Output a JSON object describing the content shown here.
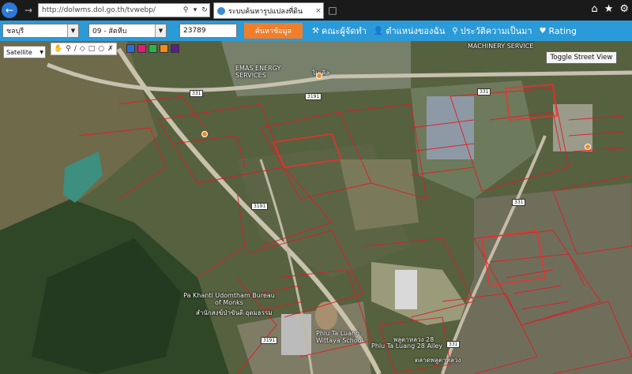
{
  "browser": {
    "url": "http://dolwms.dol.go.th/tvwebp/",
    "tab_title": "ระบบค้นหารูปแปลงที่ดิน",
    "tab_close": "×",
    "icons": [
      "back-arrow",
      "forward-arrow",
      "search",
      "refresh",
      "home",
      "star",
      "gear"
    ]
  },
  "toolbar": {
    "province": "ชลบุรี",
    "district": "09 - สัตหีบ",
    "parcel_number": "23789",
    "search_label": "ค้นหาข้อมูล",
    "menu": [
      {
        "icon": "tools-icon",
        "glyph": "⚒",
        "label": "คณะผู้จัดทำ"
      },
      {
        "icon": "user-icon",
        "glyph": "👤",
        "label": "ตำแหน่งของฉัน"
      },
      {
        "icon": "history-icon",
        "glyph": "⚲",
        "label": "ประวัติความเป็นมา"
      },
      {
        "icon": "tag-icon",
        "glyph": "♥",
        "label": "Rating"
      }
    ]
  },
  "map": {
    "map_type": "Satellite",
    "street_view_label": "Toggle Street View",
    "swatch_colors": [
      "#2a6cdc",
      "#e21a7a",
      "#2db34a",
      "#f48a1c",
      "#5b1e8c"
    ],
    "labels": [
      "EMAS ENERGY SERVICES",
      "ไมเคิล",
      "MACHINERY SERVICE",
      "Pa Khanti Udomtham Bureau of Monks",
      "สำนักสงฆ์ป่าขันติ อุดมธรรม",
      "Phlu Ta Luang Wittaya School",
      "พลูตาหลวง 28",
      "Phlu Ta Luang 28 Alley",
      "ตลาดพลูตาหลวง"
    ],
    "road_shields": [
      "331",
      "3191",
      "3191",
      "331",
      "331",
      "3191",
      "331"
    ]
  }
}
